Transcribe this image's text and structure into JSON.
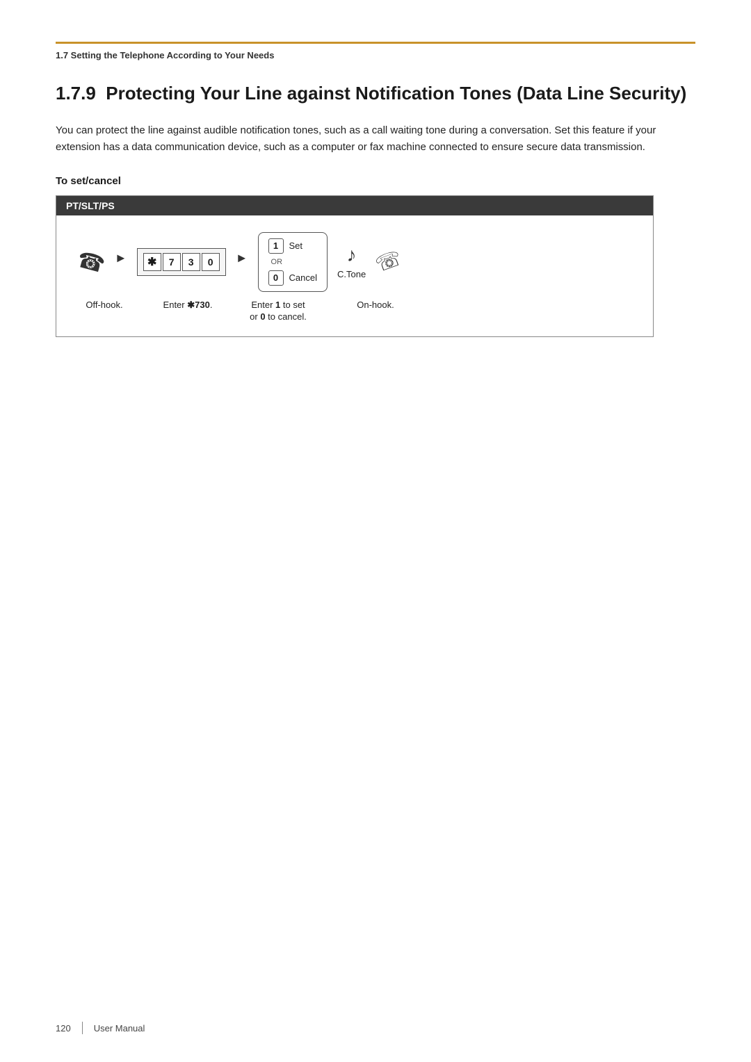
{
  "breadcrumb": "1.7 Setting the Telephone According to Your Needs",
  "section": {
    "number": "1.7.9",
    "title": "Protecting Your Line against Notification Tones (Data Line Security)"
  },
  "description": "You can protect the line against audible notification tones, such as a call waiting tone during a conversation. Set this feature if your extension has a data communication device, such as a computer or fax machine connected to ensure secure data transmission.",
  "sub_heading": "To set/cancel",
  "box_header": "PT/SLT/PS",
  "steps": {
    "offhook_caption": "Off-hook.",
    "enter_caption": "Enter ✱730.",
    "option_set_label": "Set",
    "option_or": "OR",
    "option_cancel_label": "Cancel",
    "ctone_label": "C.Tone",
    "enter_to_set_caption": "Enter 1 to set",
    "or_to_cancel_caption": "or 0 to cancel.",
    "onhook_caption": "On-hook.",
    "key_star": "✱",
    "key_7": "7",
    "key_3": "3",
    "key_0": "0",
    "option_1": "1",
    "option_0": "0"
  },
  "footer": {
    "page_number": "120",
    "label": "User Manual"
  }
}
